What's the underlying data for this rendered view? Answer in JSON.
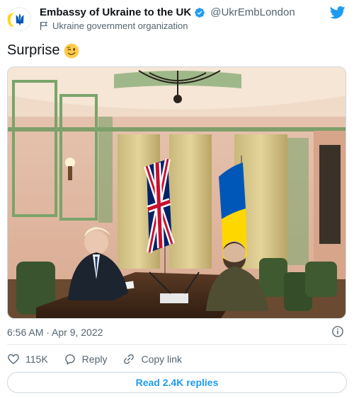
{
  "account": {
    "display_name": "Embassy of Ukraine to the UK",
    "handle": "@UkrEmbLondon",
    "affiliation": "Ukraine government organization",
    "avatar_icon": "ukraine-trident-icon",
    "verified_icon": "verified-badge-icon"
  },
  "tweet": {
    "text": "Surprise",
    "emoji": "winking-face-emoji",
    "photo_description_icon": "embassy-meeting-photo"
  },
  "meta": {
    "timestamp": "6:56 AM · Apr 9, 2022"
  },
  "actions": {
    "likes": "115K",
    "reply": "Reply",
    "copy_link": "Copy link"
  },
  "read_replies": "Read 2.4K replies",
  "colors": {
    "twitter_blue": "#1d9bf0",
    "text_primary": "#0f1419",
    "text_secondary": "#536471",
    "ukraine_blue": "#0057b7",
    "ukraine_yellow": "#ffd700"
  }
}
